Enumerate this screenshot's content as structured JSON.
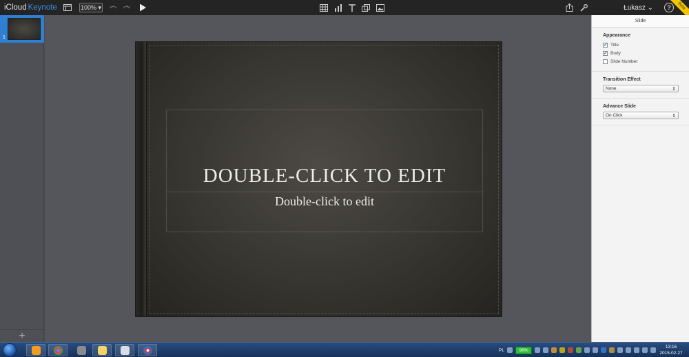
{
  "toolbar": {
    "brand_icloud": "iCloud",
    "brand_keynote": "Keynote",
    "zoom": "100%",
    "user": "Łukasz",
    "help": "?",
    "beta": "Beta"
  },
  "navigator": {
    "slide_number": "1",
    "add_label": "+"
  },
  "slide": {
    "title": "DOUBLE-CLICK TO EDIT",
    "body": "Double-click to edit"
  },
  "inspector": {
    "tab": "Slide",
    "appearance": {
      "title": "Appearance",
      "options": [
        {
          "label": "Title",
          "checked": true
        },
        {
          "label": "Body",
          "checked": true
        },
        {
          "label": "Slide Number",
          "checked": false
        }
      ]
    },
    "transition": {
      "title": "Transition Effect",
      "value": "None"
    },
    "advance": {
      "title": "Advance Slide",
      "value": "On Click"
    }
  },
  "taskbar": {
    "language": "PL",
    "battery": "98%",
    "time": "13:16",
    "date": "2015-02-27"
  },
  "colors": {
    "accent": "#3a8fde",
    "selection": "#2f7fd3",
    "battery": "#2fbf3a"
  }
}
